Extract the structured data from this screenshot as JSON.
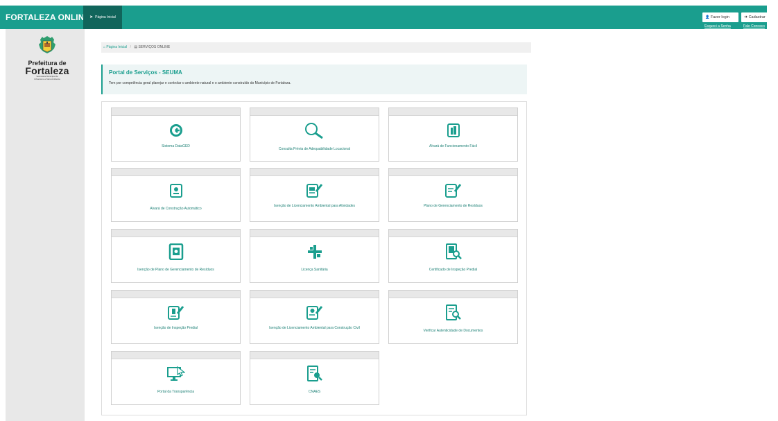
{
  "header": {
    "brand": "FORTALEZA ONLINE",
    "home_tab": "Página Inicial",
    "login_label": "Fazer login",
    "register_label": "Cadastrar",
    "forgot_password": "Esqueci a Senha",
    "contact": "Fale Conosco"
  },
  "logo": {
    "line1": "Prefeitura de",
    "line2": "Fortaleza",
    "line3": "Secretaria Municipal de",
    "line4": "Urbanismo e Meio Ambiente"
  },
  "breadcrumb": {
    "home": "Página Inicial",
    "current": "SERVIÇOS ONLINE"
  },
  "portal": {
    "title": "Portal de Serviços - SEUMA",
    "description": "Tem por competência geral planejar e controlar o ambiente natural e o ambiente construído do Município de Fortaleza."
  },
  "services": [
    {
      "label": "Sistema DataGED",
      "icon": "datagged-icon"
    },
    {
      "label": "Consulta Prévia de Adequabilidade Locacional",
      "icon": "magnifier-icon"
    },
    {
      "label": "Alvará de Funcionamento Fácil",
      "icon": "building-certificate-icon"
    },
    {
      "label": "Alvará de Construção Automático",
      "icon": "construction-certificate-icon"
    },
    {
      "label": "Isenção de Licenciamento Ambiental para Atividades",
      "icon": "document-signature-icon"
    },
    {
      "label": "Plano de Gerenciamento de Resíduos",
      "icon": "document-pencil-icon"
    },
    {
      "label": "Isenção de Plano de Gerenciamento de Resíduos",
      "icon": "recycle-document-icon"
    },
    {
      "label": "Licença Sanitária",
      "icon": "health-cross-icon"
    },
    {
      "label": "Certificado de Inspeção Predial",
      "icon": "building-search-icon"
    },
    {
      "label": "Isenção de Inspeção Predial",
      "icon": "building-document-icon"
    },
    {
      "label": "Isenção de Licenciamento Ambiental para Construção Civil",
      "icon": "worker-document-icon"
    },
    {
      "label": "Verificar Autenticidade de Documentos",
      "icon": "document-search-icon"
    },
    {
      "label": "Portal da Transparência",
      "icon": "monitor-cursor-icon"
    },
    {
      "label": "CNAES",
      "icon": "list-search-icon"
    }
  ],
  "colors": {
    "primary": "#1a9e8e",
    "primary_dark": "#11655b",
    "sidebar": "#e8e8e8",
    "card_header": "#e8e8e8"
  }
}
